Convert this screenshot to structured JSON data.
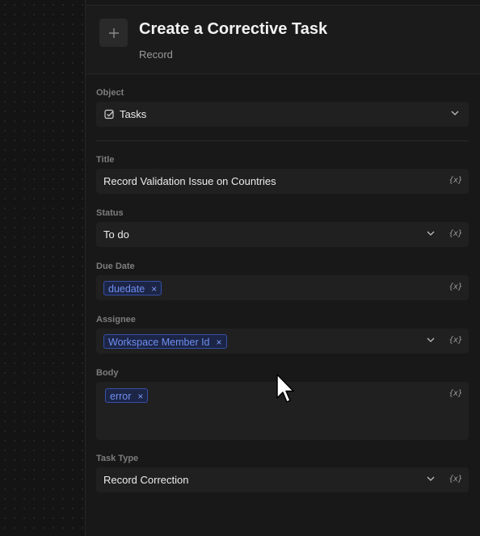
{
  "header": {
    "title": "Create a Corrective Task",
    "subtitle": "Record",
    "add_icon": "plus-icon"
  },
  "fields": {
    "object": {
      "label": "Object",
      "value": "Tasks",
      "icon": "checkbox-icon"
    },
    "title": {
      "label": "Title",
      "value": "Record Validation Issue on Countries"
    },
    "status": {
      "label": "Status",
      "value": "To do"
    },
    "due_date": {
      "label": "Due Date",
      "chip": "duedate"
    },
    "assignee": {
      "label": "Assignee",
      "chip": "Workspace Member Id"
    },
    "body": {
      "label": "Body",
      "chip": "error"
    },
    "task_type": {
      "label": "Task Type",
      "value": "Record Correction"
    }
  },
  "variable_button": "{x}",
  "chip_remove": "×",
  "colors": {
    "accent_chip": "#6f8ef0",
    "chip_bg": "#1c2546",
    "panel_bg": "#181818",
    "field_bg": "#202020"
  }
}
